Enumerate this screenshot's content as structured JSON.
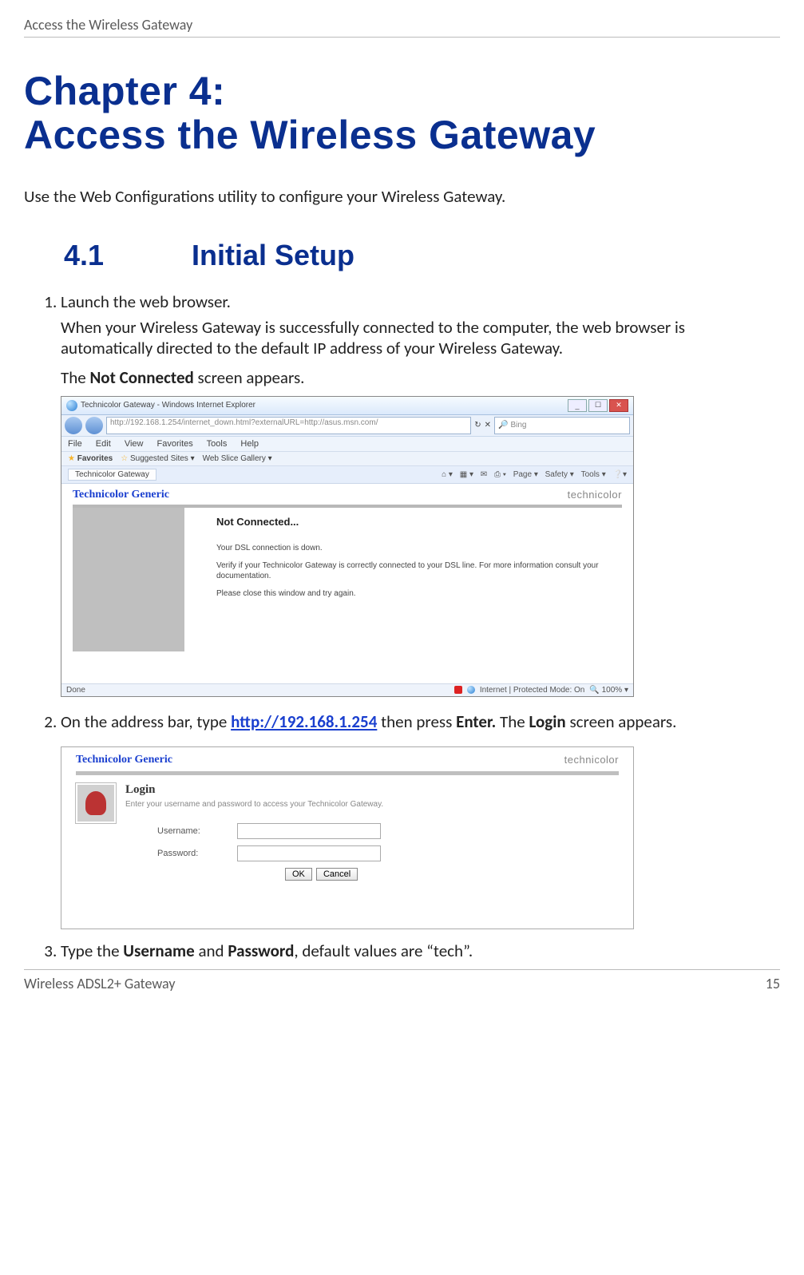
{
  "header": {
    "title": "Access the Wireless Gateway"
  },
  "chapter": {
    "line1": "Chapter 4:",
    "line2": "Access the Wireless Gateway"
  },
  "intro": "Use the Web Configurations utility to configure your Wireless Gateway.",
  "section": {
    "num": "4.1",
    "title": "Initial Setup"
  },
  "steps": {
    "s1": {
      "text": "Launch the web browser.",
      "p1": "When your Wireless Gateway is successfully connected to the computer, the web browser is automatically directed to the default IP address of your Wireless Gateway.",
      "p2a": "The ",
      "p2b": "Not Connected",
      "p2c": " screen appears."
    },
    "s2": {
      "a": "On the address bar, type ",
      "url": "http://192.168.1.254",
      "b": " then press ",
      "enter": "Enter.",
      "c": " The ",
      "login": "Login",
      "d": " screen appears."
    },
    "s3": {
      "a": "Type the ",
      "u": "Username",
      "b": " and ",
      "p": "Password",
      "c": ", default values are “tech”."
    }
  },
  "shot1": {
    "title": "Technicolor Gateway - Windows Internet Explorer",
    "url": "http://192.168.1.254/internet_down.html?externalURL=http://asus.msn.com/",
    "search_engine": "Bing",
    "menus": [
      "File",
      "Edit",
      "View",
      "Favorites",
      "Tools",
      "Help"
    ],
    "fav_label": "Favorites",
    "fav_sites": "Suggested Sites ▾",
    "fav_slice": "Web Slice Gallery ▾",
    "tab": "Technicolor Gateway",
    "tools": [
      "Page ▾",
      "Safety ▾",
      "Tools ▾"
    ],
    "brand": "Technicolor Generic",
    "logo": "technicolor",
    "nc_heading": "Not Connected...",
    "nc_l1": "Your DSL connection is down.",
    "nc_l2": "Verify if your Technicolor Gateway is correctly connected to your DSL line. For more information consult your documentation.",
    "nc_l3": "Please close this window and try again.",
    "status_left": "Done",
    "status_mid": "Internet | Protected Mode: On",
    "zoom": "100%"
  },
  "shot2": {
    "brand": "Technicolor Generic",
    "logo": "technicolor",
    "heading": "Login",
    "hint": "Enter your username and password to access your Technicolor Gateway.",
    "username_label": "Username:",
    "password_label": "Password:",
    "ok": "OK",
    "cancel": "Cancel"
  },
  "footer": {
    "left": "Wireless ADSL2+ Gateway",
    "right": "15"
  }
}
